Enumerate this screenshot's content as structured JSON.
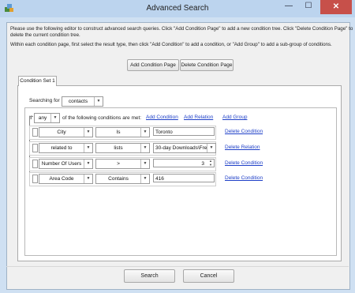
{
  "window": {
    "title": "Advanced Search",
    "close_glyph": "✕",
    "minimize_glyph": "—",
    "maximize_glyph": "☐"
  },
  "instructions": {
    "line1": "Please use the following editor to construct advanced search queries.  Click \"Add Condition Page\" to add a new condition tree.  Click \"Delete Condition Page\" to",
    "line2": "delete the current condition tree.",
    "line3": "Within each condition page, first select the result type, then click \"Add Condition\" to add a condition, or \"Add Group\" to add a sub-group of conditions."
  },
  "page_buttons": {
    "add_page": "Add Condition Page",
    "delete_page": "Delete Condition Page"
  },
  "tabs": [
    {
      "label": "Condition Set 1"
    }
  ],
  "searching": {
    "label": "Searching for",
    "value": "contacts"
  },
  "logic": {
    "if_label": "If",
    "match": "any",
    "suffix": "of the following conditions are met:",
    "add_condition": "Add Condition",
    "add_relation": "Add Relation",
    "add_group": "Add Group"
  },
  "conditions": [
    {
      "field": "City",
      "operator": "Is",
      "value": "Toronto",
      "value_kind": "text",
      "action": "Delete Condition"
    },
    {
      "field": "related to",
      "operator": "lists",
      "value": "30-day Downloads\\Fre...",
      "value_kind": "select",
      "action": "Delete Relation"
    },
    {
      "field": "Number Of Users",
      "operator": ">",
      "value": "3",
      "value_kind": "number",
      "action": "Delete Condition"
    },
    {
      "field": "Area Code",
      "operator": "Contains",
      "value": "416",
      "value_kind": "text",
      "action": "Delete Condition"
    }
  ],
  "footer": {
    "search": "Search",
    "cancel": "Cancel"
  },
  "icons": {
    "app": "app-icon",
    "dropdown": "chevron-down-icon",
    "spinner": "spinner-icon"
  }
}
